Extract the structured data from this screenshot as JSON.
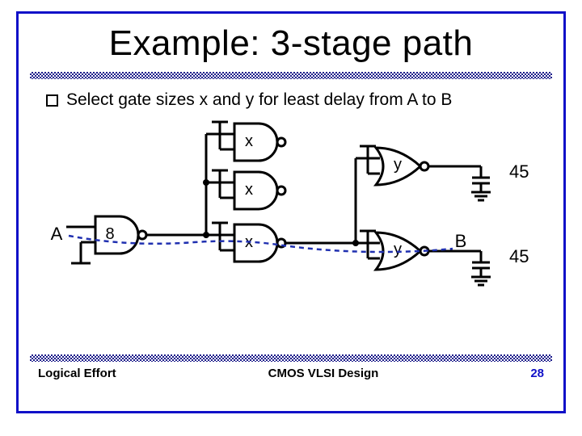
{
  "slide": {
    "title": "Example: 3-stage path",
    "bullet": "Select gate sizes x and y for least delay from A to B"
  },
  "diagram": {
    "input_label": "A",
    "input_size": "8",
    "nand_labels": [
      "x",
      "x",
      "x"
    ],
    "nor_labels": [
      "y",
      "y"
    ],
    "output_label": "B",
    "cap_values": [
      "45",
      "45"
    ]
  },
  "footer": {
    "left": "Logical Effort",
    "center": "CMOS VLSI Design",
    "page": "28"
  }
}
